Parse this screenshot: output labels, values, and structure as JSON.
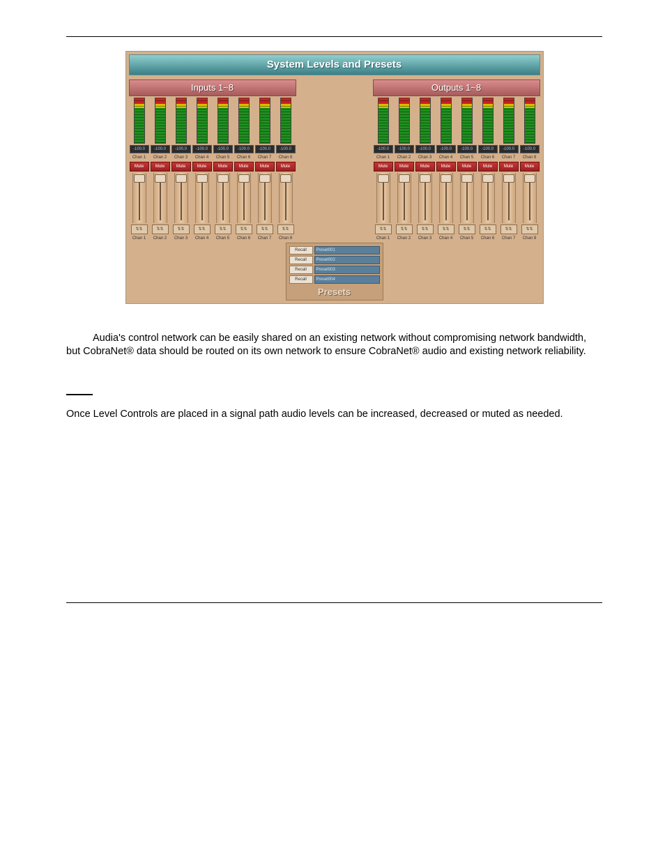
{
  "panel": {
    "title": "System Levels and Presets",
    "inputs_title": "Inputs 1~8",
    "outputs_title": "Outputs 1~8",
    "level_display": "-100.0",
    "channel_prefix": "Chan",
    "mute_label": "Mute",
    "gang_label": "⇅⇅"
  },
  "presets": {
    "title": "Presets",
    "recall_label": "Recall",
    "items": [
      "Preset001",
      "Preset002",
      "Preset003",
      "Preset004"
    ]
  },
  "text": {
    "p1": "Audia's control network can be easily shared on an existing network without compromising network bandwidth, but CobraNet® data should be routed on its own network to ensure CobraNet® audio and existing network reliability.",
    "p2": "Once Level Controls are placed in a signal path audio levels can be increased, decreased or muted as needed."
  }
}
